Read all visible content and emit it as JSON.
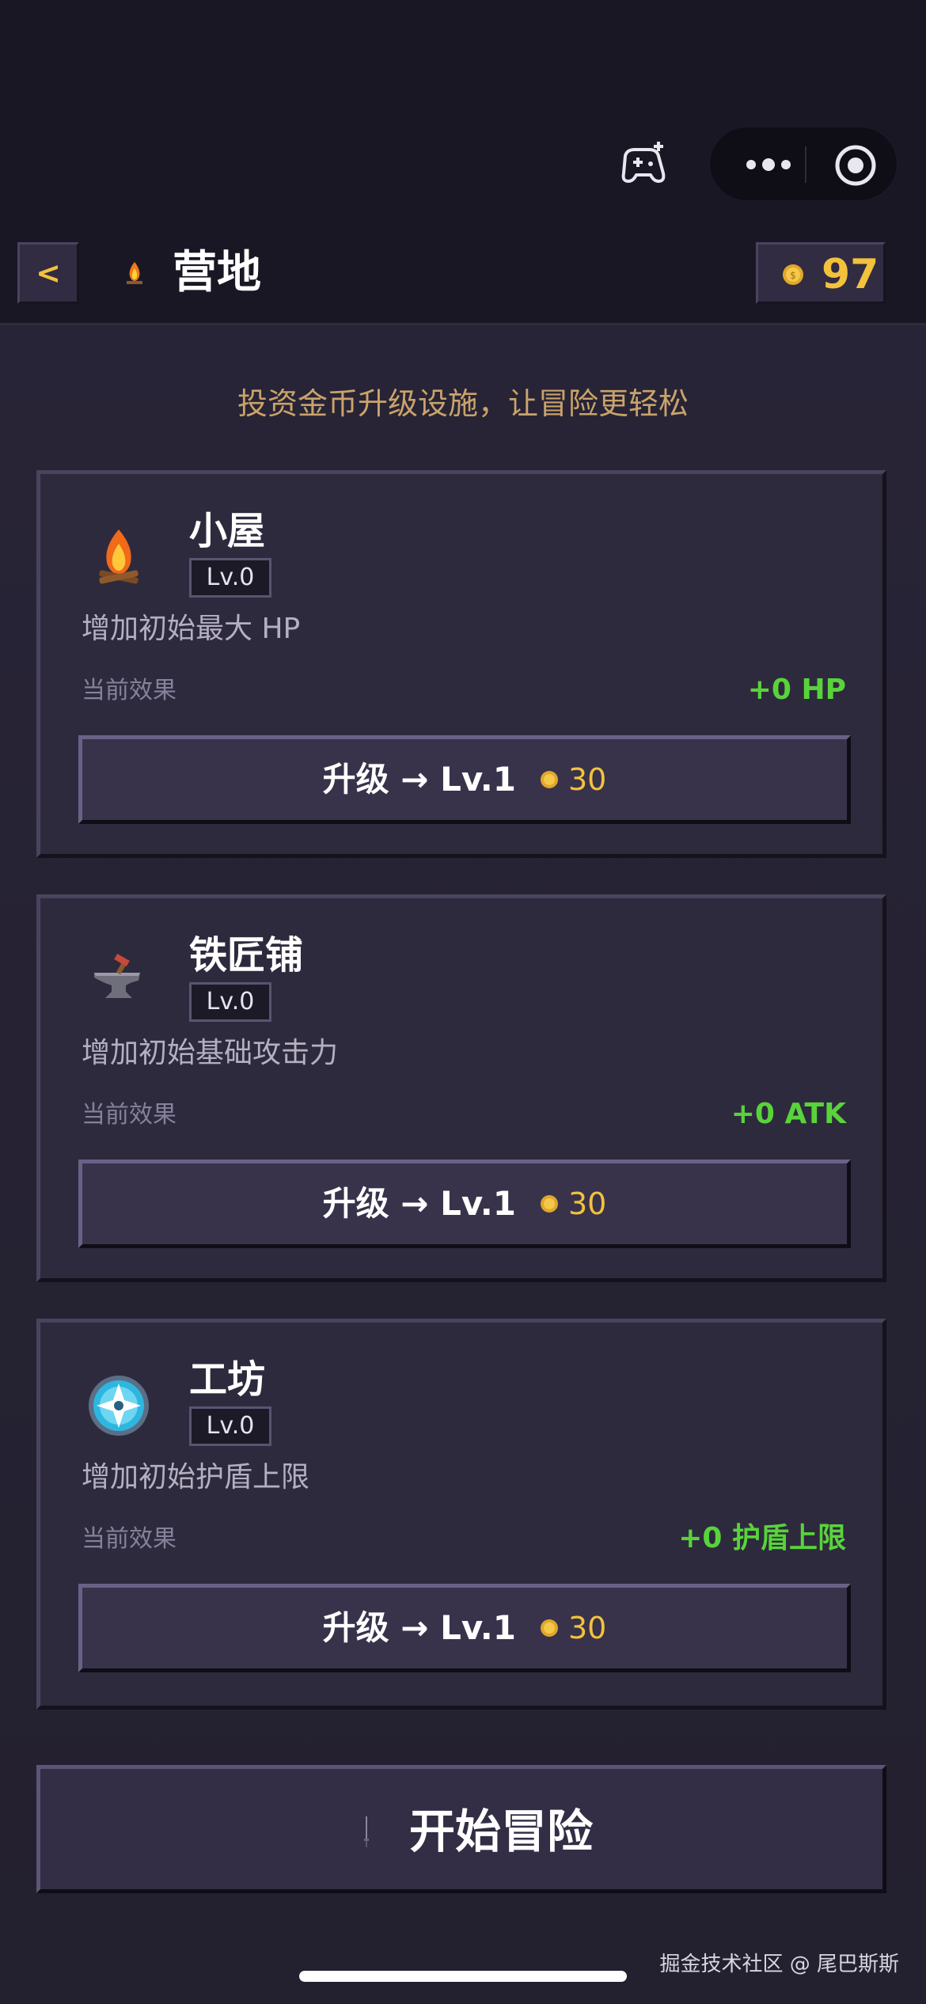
{
  "header": {
    "back_label": "<",
    "title": "营地",
    "title_icon": "campfire-icon",
    "coins": "97"
  },
  "subtitle": "投资金币升级设施，让冒险更轻松",
  "facilities": [
    {
      "name": "小屋",
      "icon": "campfire-icon",
      "level": "Lv.0",
      "description": "增加初始最大 HP",
      "effect_label": "当前效果",
      "effect_value": "+0 HP",
      "upgrade_label": "升级 → Lv.1",
      "cost": "30"
    },
    {
      "name": "铁匠铺",
      "icon": "anvil-icon",
      "level": "Lv.0",
      "description": "增加初始基础攻击力",
      "effect_label": "当前效果",
      "effect_value": "+0 ATK",
      "upgrade_label": "升级 → Lv.1",
      "cost": "30"
    },
    {
      "name": "工坊",
      "icon": "shield-icon",
      "level": "Lv.0",
      "description": "增加初始护盾上限",
      "effect_label": "当前效果",
      "effect_value": "+0 护盾上限",
      "upgrade_label": "升级 → Lv.1",
      "cost": "30"
    }
  ],
  "start_button": "开始冒险",
  "watermark": "掘金技术社区 @ 尾巴斯斯",
  "colors": {
    "accent_gold": "#f2c23d",
    "effect_green": "#58d43a",
    "card_bg": "#2e2a3d",
    "page_bg": "#23202f"
  }
}
